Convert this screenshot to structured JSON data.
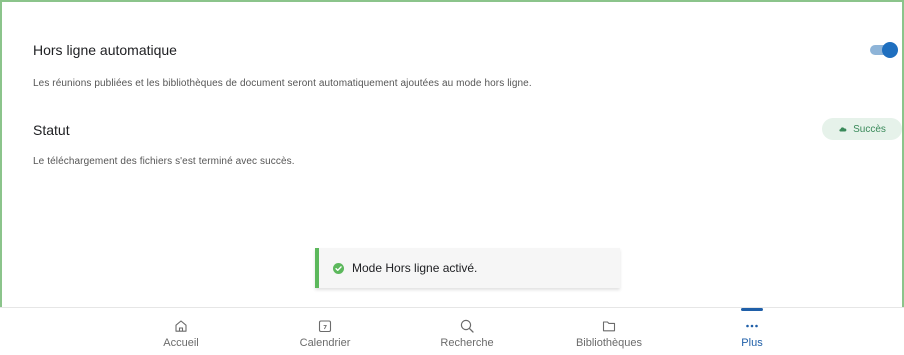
{
  "settings": {
    "offline_title": "Hors ligne automatique",
    "offline_desc": "Les réunions publiées et les bibliothèques de document seront automatiquement ajoutées au mode hors ligne.",
    "status_title": "Statut",
    "status_badge": "Succès",
    "status_desc": "Le téléchargement des fichiers s'est terminé avec succès.",
    "toggle_on": true
  },
  "toast": {
    "message": "Mode Hors ligne activé."
  },
  "nav": {
    "items": [
      {
        "label": "Accueil",
        "icon": "home-icon"
      },
      {
        "label": "Calendrier",
        "icon": "calendar-icon"
      },
      {
        "label": "Recherche",
        "icon": "search-icon"
      },
      {
        "label": "Bibliothèques",
        "icon": "folder-icon"
      },
      {
        "label": "Plus",
        "icon": "more-icon",
        "active": true
      }
    ]
  },
  "colors": {
    "accent": "#1f5fa8",
    "toggle": "#1f6fbf",
    "success": "#5cb85c",
    "badge_bg": "#e6f2ea",
    "frame": "#8bc48b"
  }
}
